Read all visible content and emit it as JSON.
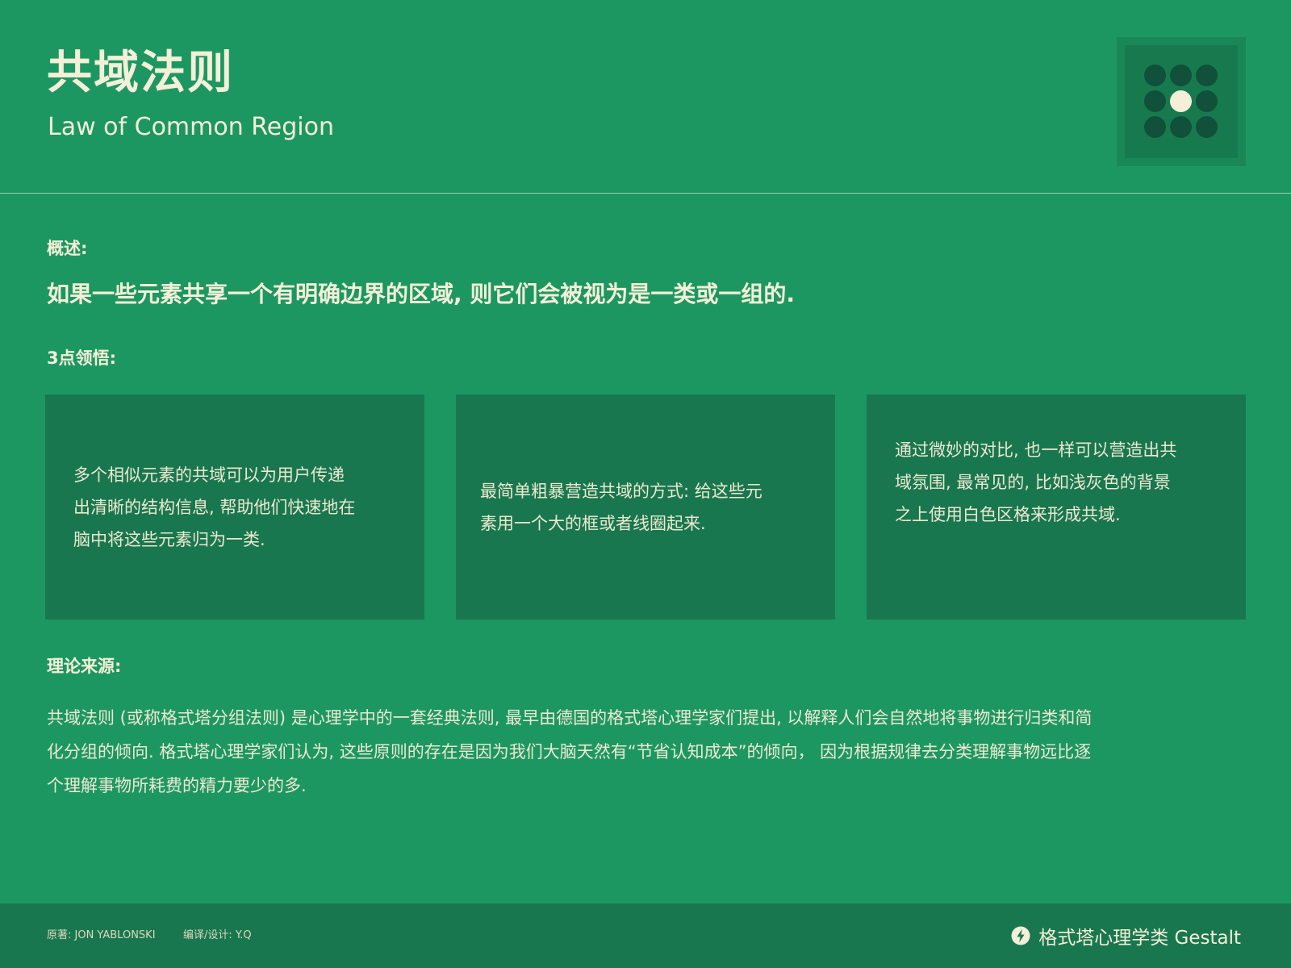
{
  "header": {
    "title": "共域法则",
    "subtitle": "Law of Common Region",
    "logo_icon": "nine-dot-grid-icon"
  },
  "overview": {
    "label": "概述:",
    "text": "如果一些元素共享一个有明确边界的区域, 则它们会被视为是一类或一组的."
  },
  "insights": {
    "label": "3点领悟:",
    "cards": [
      {
        "lines": [
          "多个相似元素的共域可以为用户传递",
          "出清晰的结构信息, 帮助他们快速地在",
          "脑中将这些元素归为一类."
        ]
      },
      {
        "lines": [
          "最简单粗暴营造共域的方式: 给这些元",
          "素用一个大的框或者线圈起来."
        ]
      },
      {
        "lines": [
          "通过微妙的对比, 也一样可以营造出共",
          "域氛围, 最常见的, 比如浅灰色的背景",
          "之上使用白色区格来形成共域."
        ]
      }
    ]
  },
  "source": {
    "label": "理论来源:",
    "lines": [
      "共域法则 (或称格式塔分组法则) 是心理学中的一套经典法则, 最早由德国的格式塔心理学家们提出, 以解释人们会自然地将事物进行归类和简",
      "化分组的倾向. 格式塔心理学家们认为, 这些原则的存在是因为我们大脑天然有“节省认知成本”的倾向， 因为根据规律去分类理解事物远比逐",
      "个理解事物所耗费的精力要少的多."
    ]
  },
  "footer": {
    "original": "原著: JON YABLONSKI",
    "translator": "编译/设计: Y.Q",
    "brand": "格式塔心理学类 Gestalt",
    "brand_icon": "lightning-bolt-icon"
  },
  "colors": {
    "background": "#1d9762",
    "card": "#19774f",
    "text": "#f3efd8",
    "dot_dark": "#11503a"
  }
}
